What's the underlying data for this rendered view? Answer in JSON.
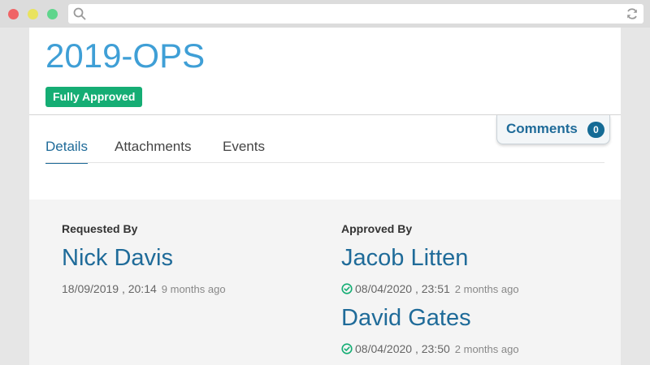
{
  "record": {
    "title": "2019-OPS",
    "status": "Fully Approved"
  },
  "comments": {
    "label": "Comments",
    "count": "0"
  },
  "tabs": [
    {
      "label": "Details",
      "active": true
    },
    {
      "label": "Attachments",
      "active": false
    },
    {
      "label": "Events",
      "active": false
    }
  ],
  "requested": {
    "heading": "Requested By",
    "name": "Nick Davis",
    "datetime": "18/09/2019 , 20:14",
    "ago": "9 months ago"
  },
  "approved": {
    "heading": "Approved By",
    "approvers": [
      {
        "name": "Jacob Litten",
        "datetime": "08/04/2020 , 23:51",
        "ago": "2 months ago"
      },
      {
        "name": "David Gates",
        "datetime": "08/04/2020 , 23:50",
        "ago": "2 months ago"
      }
    ]
  },
  "colors": {
    "title": "#3f9fd6",
    "badge": "#15ad74",
    "link": "#1f6b99",
    "approved_check": "#15ad74"
  },
  "icons": {
    "url_left": "search-icon",
    "url_right": "reload-icon",
    "approval": "check-circle-icon"
  }
}
